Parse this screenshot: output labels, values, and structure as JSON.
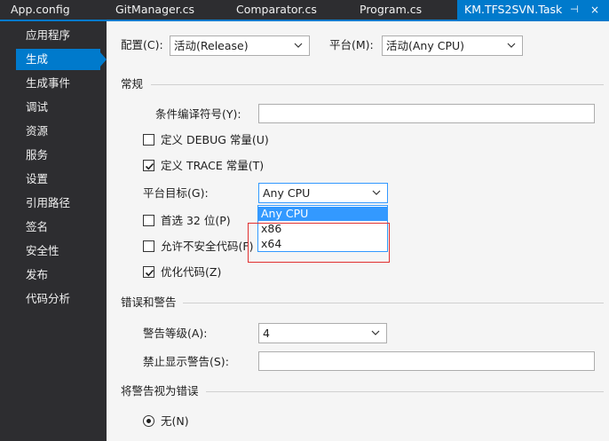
{
  "tabs": [
    {
      "label": "App.config"
    },
    {
      "label": "GitManager.cs"
    },
    {
      "label": "Comparator.cs"
    },
    {
      "label": "Program.cs"
    },
    {
      "label": "KM.TFS2SVN.Task",
      "pin": "⊣",
      "close": "×"
    }
  ],
  "sidebar": {
    "items": [
      {
        "label": "应用程序"
      },
      {
        "label": "生成"
      },
      {
        "label": "生成事件"
      },
      {
        "label": "调试"
      },
      {
        "label": "资源"
      },
      {
        "label": "服务"
      },
      {
        "label": "设置"
      },
      {
        "label": "引用路径"
      },
      {
        "label": "签名"
      },
      {
        "label": "安全性"
      },
      {
        "label": "发布"
      },
      {
        "label": "代码分析"
      }
    ],
    "active_index": 1
  },
  "config": {
    "configuration_label": "配置(C):",
    "configuration_value": "活动(Release)",
    "platform_label": "平台(M):",
    "platform_value": "活动(Any CPU)"
  },
  "general": {
    "title": "常规",
    "conditional_symbols_label": "条件编译符号(Y):",
    "conditional_symbols_value": "",
    "define_debug_label": "定义 DEBUG 常量(U)",
    "define_debug_checked": false,
    "define_trace_label": "定义 TRACE 常量(T)",
    "define_trace_checked": true,
    "platform_target_label": "平台目标(G):",
    "platform_target_value": "Any CPU",
    "platform_target_options": [
      "Any CPU",
      "x86",
      "x64"
    ],
    "prefer32_label": "首选 32 位(P)",
    "prefer32_checked": false,
    "unsafe_label": "允许不安全代码(F)",
    "unsafe_checked": false,
    "optimize_label": "优化代码(Z)",
    "optimize_checked": true
  },
  "errors": {
    "title": "错误和警告",
    "warning_level_label": "警告等级(A):",
    "warning_level_value": "4",
    "suppress_label": "禁止显示警告(S):",
    "suppress_value": ""
  },
  "treat_warnings": {
    "title": "将警告视为错误",
    "none_label": "无(N)",
    "none_selected": true
  },
  "colors": {
    "accent": "#007acc",
    "highlight": "#3399ff",
    "annotation": "#e03030"
  }
}
